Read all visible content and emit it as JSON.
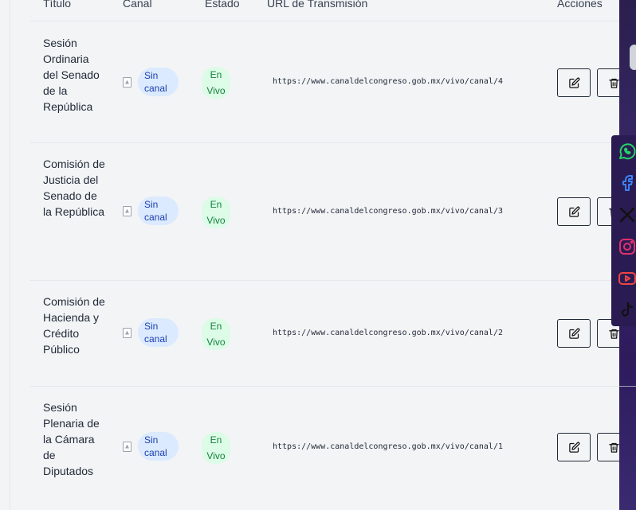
{
  "table": {
    "headers": {
      "title": "Título",
      "canal": "Canal",
      "estado": "Estado",
      "url": "URL de Transmisión",
      "acciones": "Acciones"
    },
    "rows": [
      {
        "title": "Sesión Ordinaria del Senado de la República",
        "canal": "Sin canal",
        "estado": "En Vivo",
        "url": "https://www.canaldelcongreso.gob.mx/vivo/canal/4"
      },
      {
        "title": "Comisión de Justicia del Senado de la República",
        "canal": "Sin canal",
        "estado": "En Vivo",
        "url": "https://www.canaldelcongreso.gob.mx/vivo/canal/3"
      },
      {
        "title": "Comisión de Hacienda y Crédito Público",
        "canal": "Sin canal",
        "estado": "En Vivo",
        "url": "https://www.canaldelcongreso.gob.mx/vivo/canal/2"
      },
      {
        "title": "Sesión Plenaria de la Cámara de Diputados",
        "canal": "Sin canal",
        "estado": "En Vivo",
        "url": "https://www.canaldelcongreso.gob.mx/vivo/canal/1"
      }
    ]
  },
  "icons": {
    "edit": "edit-icon",
    "delete": "trash-icon",
    "broken_image": "broken-image-icon"
  },
  "social": [
    {
      "name": "whatsapp-icon",
      "color": "#25d366"
    },
    {
      "name": "facebook-icon",
      "color": "#3b82f6"
    },
    {
      "name": "x-icon",
      "color": "#111111"
    },
    {
      "name": "instagram-icon",
      "color": "#e1306c"
    },
    {
      "name": "youtube-icon",
      "color": "#ef4444"
    },
    {
      "name": "tiktok-icon",
      "color": "#111111"
    }
  ],
  "colors": {
    "canal_pill_bg": "#dbeafe",
    "canal_pill_text": "#1e40af",
    "estado_pill_bg": "#dcfce7",
    "estado_pill_text": "#15803d"
  }
}
